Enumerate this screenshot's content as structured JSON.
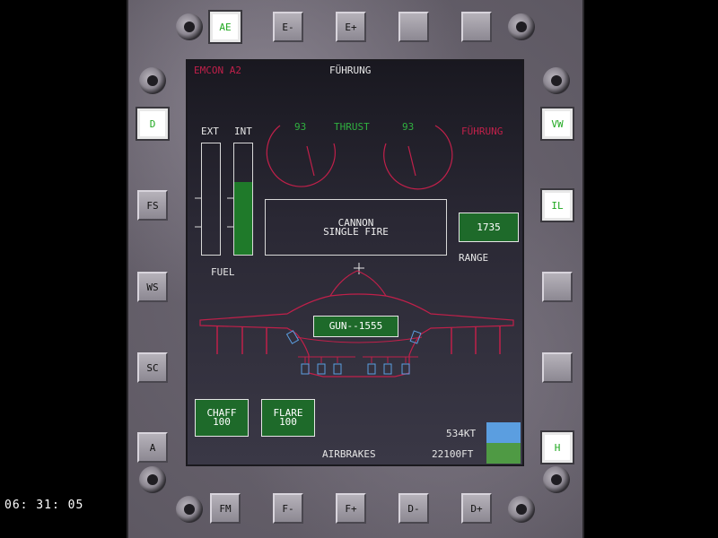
{
  "top_buttons": [
    {
      "label": "AE",
      "active": true
    },
    {
      "label": "E-",
      "active": false
    },
    {
      "label": "E+",
      "active": false
    },
    {
      "label": "",
      "active": false
    },
    {
      "label": "",
      "active": false
    }
  ],
  "left_buttons": [
    {
      "label": "D",
      "active": true
    },
    {
      "label": "FS",
      "active": false
    },
    {
      "label": "WS",
      "active": false
    },
    {
      "label": "SC",
      "active": false
    },
    {
      "label": "A",
      "active": false
    }
  ],
  "right_buttons": [
    {
      "label": "VW",
      "active": true
    },
    {
      "label": "IL",
      "active": true
    },
    {
      "label": "",
      "active": false
    },
    {
      "label": "",
      "active": false
    },
    {
      "label": "H",
      "active": true
    }
  ],
  "bottom_buttons": [
    {
      "label": "FM"
    },
    {
      "label": "F-"
    },
    {
      "label": "F+"
    },
    {
      "label": "D-"
    },
    {
      "label": "D+"
    }
  ],
  "mfd": {
    "emcon": "EMCON A2",
    "mode_top": "FÜHRUNG",
    "mode_right": "FÜHRUNG",
    "thrust_label": "THRUST",
    "thrust_left": "93",
    "thrust_right": "93",
    "fuel_ext_label": "EXT",
    "fuel_int_label": "INT",
    "fuel_label": "FUEL",
    "fuel_ext_level": 0,
    "fuel_int_level": 0.65,
    "weapon_line1": "CANNON",
    "weapon_line2": "SINGLE FIRE",
    "range_value": "1735",
    "range_label": "RANGE",
    "gun_ammo": "GUN--1555",
    "chaff_label": "CHAFF",
    "chaff_count": "100",
    "flare_label": "FLARE",
    "flare_count": "100",
    "airbrakes": "AIRBRAKES",
    "speed": "534KT",
    "altitude": "22100FT"
  },
  "clock": "06: 31: 05",
  "colors": {
    "accent_pink": "#c0204a",
    "accent_green": "#30b040",
    "panel_green": "#1e6a2a",
    "sky": "#5b9ee0",
    "ground": "#4f9a44"
  }
}
